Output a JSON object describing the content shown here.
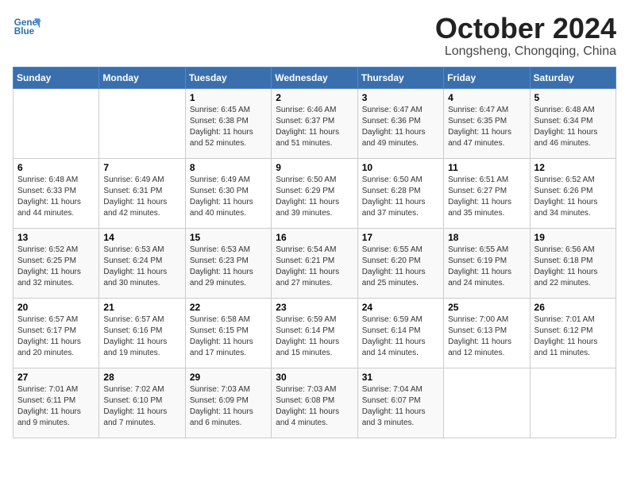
{
  "header": {
    "logo_line1": "General",
    "logo_line2": "Blue",
    "month": "October 2024",
    "location": "Longsheng, Chongqing, China"
  },
  "days_of_week": [
    "Sunday",
    "Monday",
    "Tuesday",
    "Wednesday",
    "Thursday",
    "Friday",
    "Saturday"
  ],
  "weeks": [
    [
      {
        "day": "",
        "detail": ""
      },
      {
        "day": "",
        "detail": ""
      },
      {
        "day": "1",
        "detail": "Sunrise: 6:45 AM\nSunset: 6:38 PM\nDaylight: 11 hours and 52 minutes."
      },
      {
        "day": "2",
        "detail": "Sunrise: 6:46 AM\nSunset: 6:37 PM\nDaylight: 11 hours and 51 minutes."
      },
      {
        "day": "3",
        "detail": "Sunrise: 6:47 AM\nSunset: 6:36 PM\nDaylight: 11 hours and 49 minutes."
      },
      {
        "day": "4",
        "detail": "Sunrise: 6:47 AM\nSunset: 6:35 PM\nDaylight: 11 hours and 47 minutes."
      },
      {
        "day": "5",
        "detail": "Sunrise: 6:48 AM\nSunset: 6:34 PM\nDaylight: 11 hours and 46 minutes."
      }
    ],
    [
      {
        "day": "6",
        "detail": "Sunrise: 6:48 AM\nSunset: 6:33 PM\nDaylight: 11 hours and 44 minutes."
      },
      {
        "day": "7",
        "detail": "Sunrise: 6:49 AM\nSunset: 6:31 PM\nDaylight: 11 hours and 42 minutes."
      },
      {
        "day": "8",
        "detail": "Sunrise: 6:49 AM\nSunset: 6:30 PM\nDaylight: 11 hours and 40 minutes."
      },
      {
        "day": "9",
        "detail": "Sunrise: 6:50 AM\nSunset: 6:29 PM\nDaylight: 11 hours and 39 minutes."
      },
      {
        "day": "10",
        "detail": "Sunrise: 6:50 AM\nSunset: 6:28 PM\nDaylight: 11 hours and 37 minutes."
      },
      {
        "day": "11",
        "detail": "Sunrise: 6:51 AM\nSunset: 6:27 PM\nDaylight: 11 hours and 35 minutes."
      },
      {
        "day": "12",
        "detail": "Sunrise: 6:52 AM\nSunset: 6:26 PM\nDaylight: 11 hours and 34 minutes."
      }
    ],
    [
      {
        "day": "13",
        "detail": "Sunrise: 6:52 AM\nSunset: 6:25 PM\nDaylight: 11 hours and 32 minutes."
      },
      {
        "day": "14",
        "detail": "Sunrise: 6:53 AM\nSunset: 6:24 PM\nDaylight: 11 hours and 30 minutes."
      },
      {
        "day": "15",
        "detail": "Sunrise: 6:53 AM\nSunset: 6:23 PM\nDaylight: 11 hours and 29 minutes."
      },
      {
        "day": "16",
        "detail": "Sunrise: 6:54 AM\nSunset: 6:21 PM\nDaylight: 11 hours and 27 minutes."
      },
      {
        "day": "17",
        "detail": "Sunrise: 6:55 AM\nSunset: 6:20 PM\nDaylight: 11 hours and 25 minutes."
      },
      {
        "day": "18",
        "detail": "Sunrise: 6:55 AM\nSunset: 6:19 PM\nDaylight: 11 hours and 24 minutes."
      },
      {
        "day": "19",
        "detail": "Sunrise: 6:56 AM\nSunset: 6:18 PM\nDaylight: 11 hours and 22 minutes."
      }
    ],
    [
      {
        "day": "20",
        "detail": "Sunrise: 6:57 AM\nSunset: 6:17 PM\nDaylight: 11 hours and 20 minutes."
      },
      {
        "day": "21",
        "detail": "Sunrise: 6:57 AM\nSunset: 6:16 PM\nDaylight: 11 hours and 19 minutes."
      },
      {
        "day": "22",
        "detail": "Sunrise: 6:58 AM\nSunset: 6:15 PM\nDaylight: 11 hours and 17 minutes."
      },
      {
        "day": "23",
        "detail": "Sunrise: 6:59 AM\nSunset: 6:14 PM\nDaylight: 11 hours and 15 minutes."
      },
      {
        "day": "24",
        "detail": "Sunrise: 6:59 AM\nSunset: 6:14 PM\nDaylight: 11 hours and 14 minutes."
      },
      {
        "day": "25",
        "detail": "Sunrise: 7:00 AM\nSunset: 6:13 PM\nDaylight: 11 hours and 12 minutes."
      },
      {
        "day": "26",
        "detail": "Sunrise: 7:01 AM\nSunset: 6:12 PM\nDaylight: 11 hours and 11 minutes."
      }
    ],
    [
      {
        "day": "27",
        "detail": "Sunrise: 7:01 AM\nSunset: 6:11 PM\nDaylight: 11 hours and 9 minutes."
      },
      {
        "day": "28",
        "detail": "Sunrise: 7:02 AM\nSunset: 6:10 PM\nDaylight: 11 hours and 7 minutes."
      },
      {
        "day": "29",
        "detail": "Sunrise: 7:03 AM\nSunset: 6:09 PM\nDaylight: 11 hours and 6 minutes."
      },
      {
        "day": "30",
        "detail": "Sunrise: 7:03 AM\nSunset: 6:08 PM\nDaylight: 11 hours and 4 minutes."
      },
      {
        "day": "31",
        "detail": "Sunrise: 7:04 AM\nSunset: 6:07 PM\nDaylight: 11 hours and 3 minutes."
      },
      {
        "day": "",
        "detail": ""
      },
      {
        "day": "",
        "detail": ""
      }
    ]
  ]
}
